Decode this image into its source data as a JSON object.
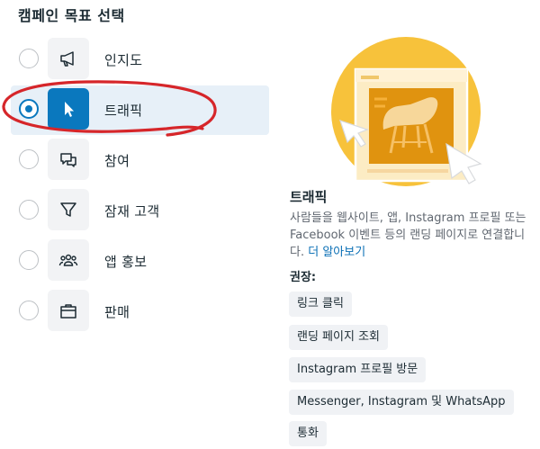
{
  "page_title": "캠페인 목표 선택",
  "objectives": [
    {
      "label": "인지도",
      "icon": "megaphone-icon",
      "selected": false
    },
    {
      "label": "트래픽",
      "icon": "cursor-icon",
      "selected": true
    },
    {
      "label": "참여",
      "icon": "chat-bubbles-icon",
      "selected": false
    },
    {
      "label": "잠재 고객",
      "icon": "funnel-icon",
      "selected": false
    },
    {
      "label": "앱 홍보",
      "icon": "people-icon",
      "selected": false
    },
    {
      "label": "판매",
      "icon": "shopping-bag-icon",
      "selected": false
    }
  ],
  "detail": {
    "title": "트래픽",
    "description": "사람들을 웹사이트, 앱, Instagram 프로필 또는 Facebook 이벤트 등의 랜딩 페이지로 연결합니다.",
    "learn_more": "더 알아보기",
    "recommended_label": "권장:",
    "recommendations": [
      "링크 클릭",
      "랜딩 페이지 조회",
      "Instagram 프로필 방문",
      "Messenger, Instagram 및 WhatsApp",
      "통화"
    ]
  },
  "colors": {
    "accent": "#0a78be",
    "selected_bg": "#e7f0f8",
    "annotation": "#d6262a",
    "illustration_yellow": "#f7c23b",
    "illustration_orange": "#e0930f"
  }
}
